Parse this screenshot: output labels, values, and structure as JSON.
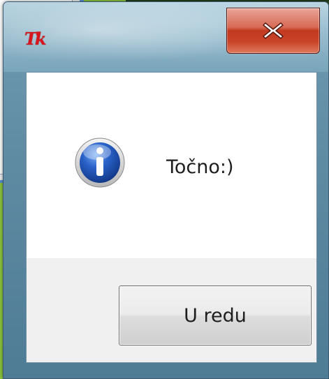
{
  "dialog": {
    "app_icon_text": "Tk",
    "message": "Točno:)",
    "ok_label": "U redu",
    "close_glyph": "X"
  },
  "icons": {
    "app": "tk-feather-icon",
    "message": "info-icon",
    "close": "close-icon"
  },
  "colors": {
    "close_button": "#c9452a",
    "info_icon": "#2a62c9",
    "app_icon": "#d8141c",
    "desktop": "#8dc63f"
  }
}
